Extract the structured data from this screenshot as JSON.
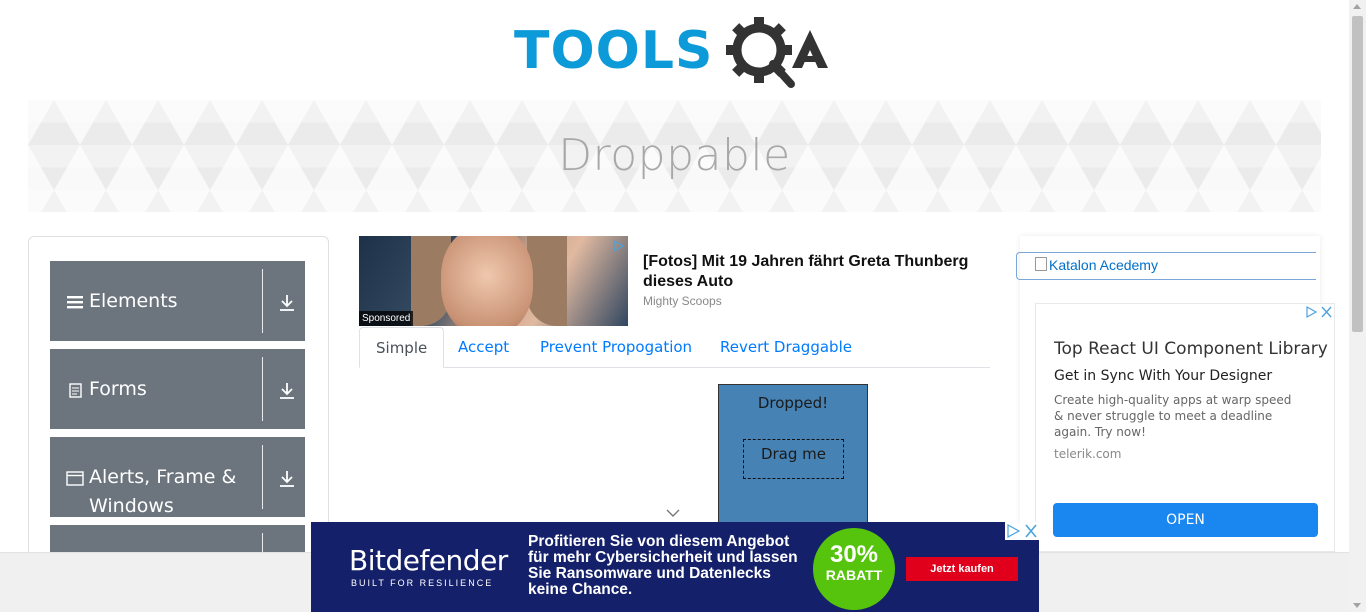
{
  "header": {
    "logo_text": "TOOLSQA"
  },
  "banner": {
    "title": "Droppable"
  },
  "sidebar": {
    "groups": [
      {
        "label": "Elements",
        "icon": "hamburger-icon"
      },
      {
        "label": "Forms",
        "icon": "document-icon"
      },
      {
        "label": "Alerts, Frame & Windows",
        "icon": "window-icon"
      },
      {
        "label": "",
        "icon": ""
      }
    ]
  },
  "sponsored_ad": {
    "badge": "Sponsored",
    "headline": "[Fotos] Mit 19 Jahren fährt Greta Thunberg dieses Auto",
    "source": "Mighty Scoops"
  },
  "tabs": [
    {
      "label": "Simple",
      "active": true
    },
    {
      "label": "Accept",
      "active": false
    },
    {
      "label": "Prevent Propogation",
      "active": false
    },
    {
      "label": "Revert Draggable",
      "active": false
    }
  ],
  "droppable": {
    "drop_label": "Dropped!",
    "drag_label": "Drag me",
    "drop_color": "#4682b4"
  },
  "right_ads": {
    "katalon_alt": "Katalon Acedemy",
    "react_ad": {
      "title": "Top React UI Component Library",
      "subtitle": "Get in Sync With Your Designer",
      "body": "Create high-quality apps at warp speed & never struggle to meet a deadline again. Try now!",
      "site": "telerik.com",
      "button": "OPEN"
    }
  },
  "bottom_ad": {
    "brand": "Bitdefender",
    "brand_sub": "BUILT FOR RESILIENCE",
    "text": "Profitieren Sie von diesem Angebot für mehr Cybersicherheit und lassen Sie Ransomware und Datenlecks keine Chance.",
    "badge_pct": "30%",
    "badge_label": "RABATT",
    "cta": "Jetzt kaufen"
  },
  "colors": {
    "sidebar_group": "#6c757d",
    "link": "#007bff",
    "logo_blue": "#0d9ad9",
    "logo_dark": "#333333"
  }
}
